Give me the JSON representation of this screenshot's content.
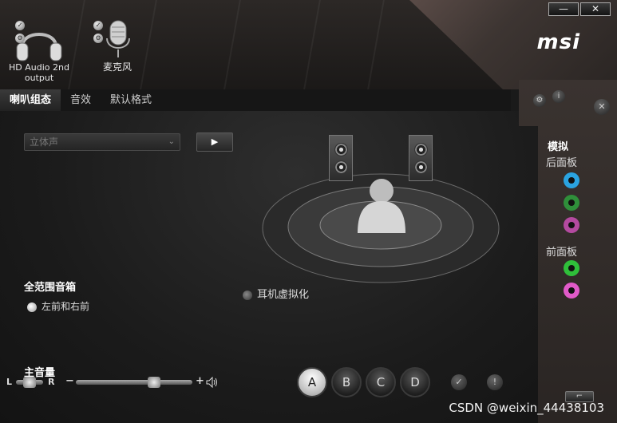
{
  "window": {
    "minimize_label": "—",
    "close_label": "✕"
  },
  "brand": {
    "logo_text": "msi"
  },
  "devices": [
    {
      "label_line1": "HD Audio 2nd",
      "label_line2": "output",
      "icon": "headphones-icon"
    },
    {
      "label_line1": "麦克风",
      "icon": "microphone-icon"
    }
  ],
  "tabs": [
    {
      "label": "喇叭组态",
      "active": true
    },
    {
      "label": "音效",
      "active": false
    },
    {
      "label": "默认格式",
      "active": false
    }
  ],
  "speaker_config": {
    "select_value": "立体声",
    "play_icon": "▶"
  },
  "full_range": {
    "title": "全范围音箱",
    "option_label": "左前和右前"
  },
  "headphone_virtualization": {
    "label": "耳机虚拟化"
  },
  "master_volume": {
    "title": "主音量",
    "left_label": "L",
    "right_label": "R",
    "minus": "−",
    "plus": "+",
    "balance": 0.5,
    "level": 0.67
  },
  "profiles": [
    "A",
    "B",
    "C",
    "D"
  ],
  "right_panel": {
    "analog_title": "模拟",
    "back_panel_title": "后面板",
    "front_panel_title": "前面板",
    "back_jacks": [
      "#2aa3e0",
      "#2f8f3a",
      "#b44aa0"
    ],
    "front_jacks": [
      "#2fbf3a",
      "#e05ac8"
    ]
  },
  "watermark": "CSDN @weixin_44438103",
  "colors": {
    "accent_blue": "#2aa3e0",
    "accent_green": "#2fbf3a",
    "accent_pink": "#e05ac8"
  }
}
